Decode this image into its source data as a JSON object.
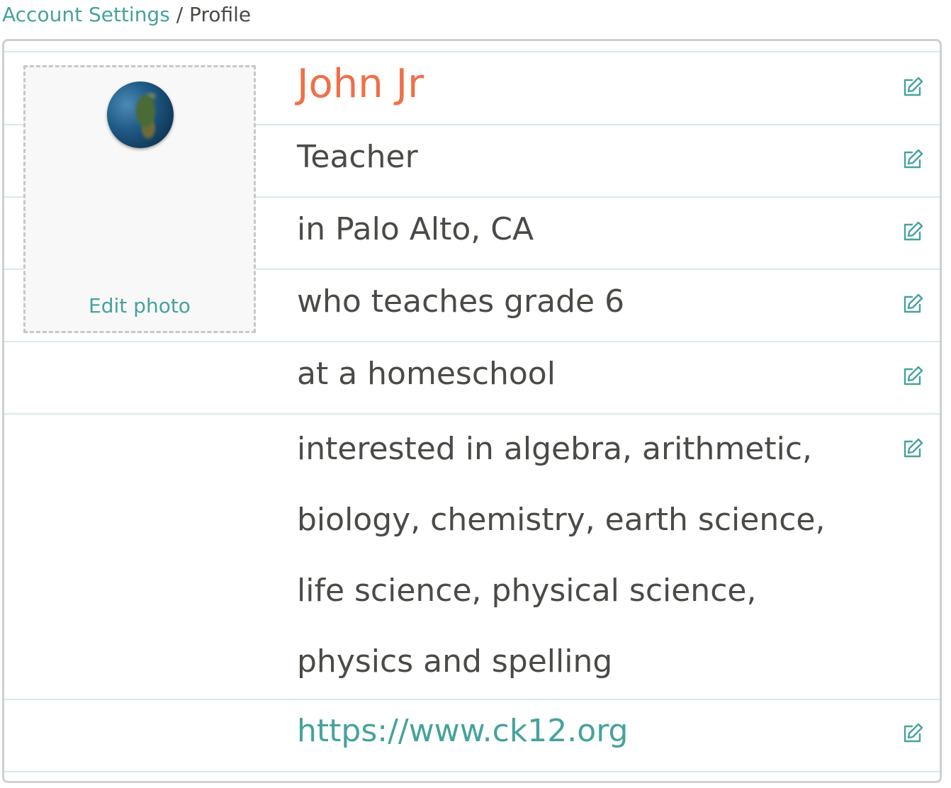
{
  "breadcrumb": {
    "parent": "Account Settings",
    "separator": "/",
    "current": "Profile"
  },
  "photo": {
    "edit_label": "Edit photo"
  },
  "profile": {
    "name": "John Jr",
    "role": "Teacher",
    "location": "in Palo Alto, CA",
    "grade": "who teaches grade 6",
    "school": "at a homeschool",
    "interests": "interested in algebra, arithmetic, biology, chemistry, earth science, life science, physical science, physics and spelling",
    "website": "https://www.ck12.org"
  },
  "icons": {
    "edit": "edit-pencil-square-icon",
    "avatar": "globe-icon"
  },
  "colors": {
    "accent": "#45a39c",
    "name": "#ee7048",
    "text": "#4a4a46",
    "divider": "#d6ebe8"
  }
}
